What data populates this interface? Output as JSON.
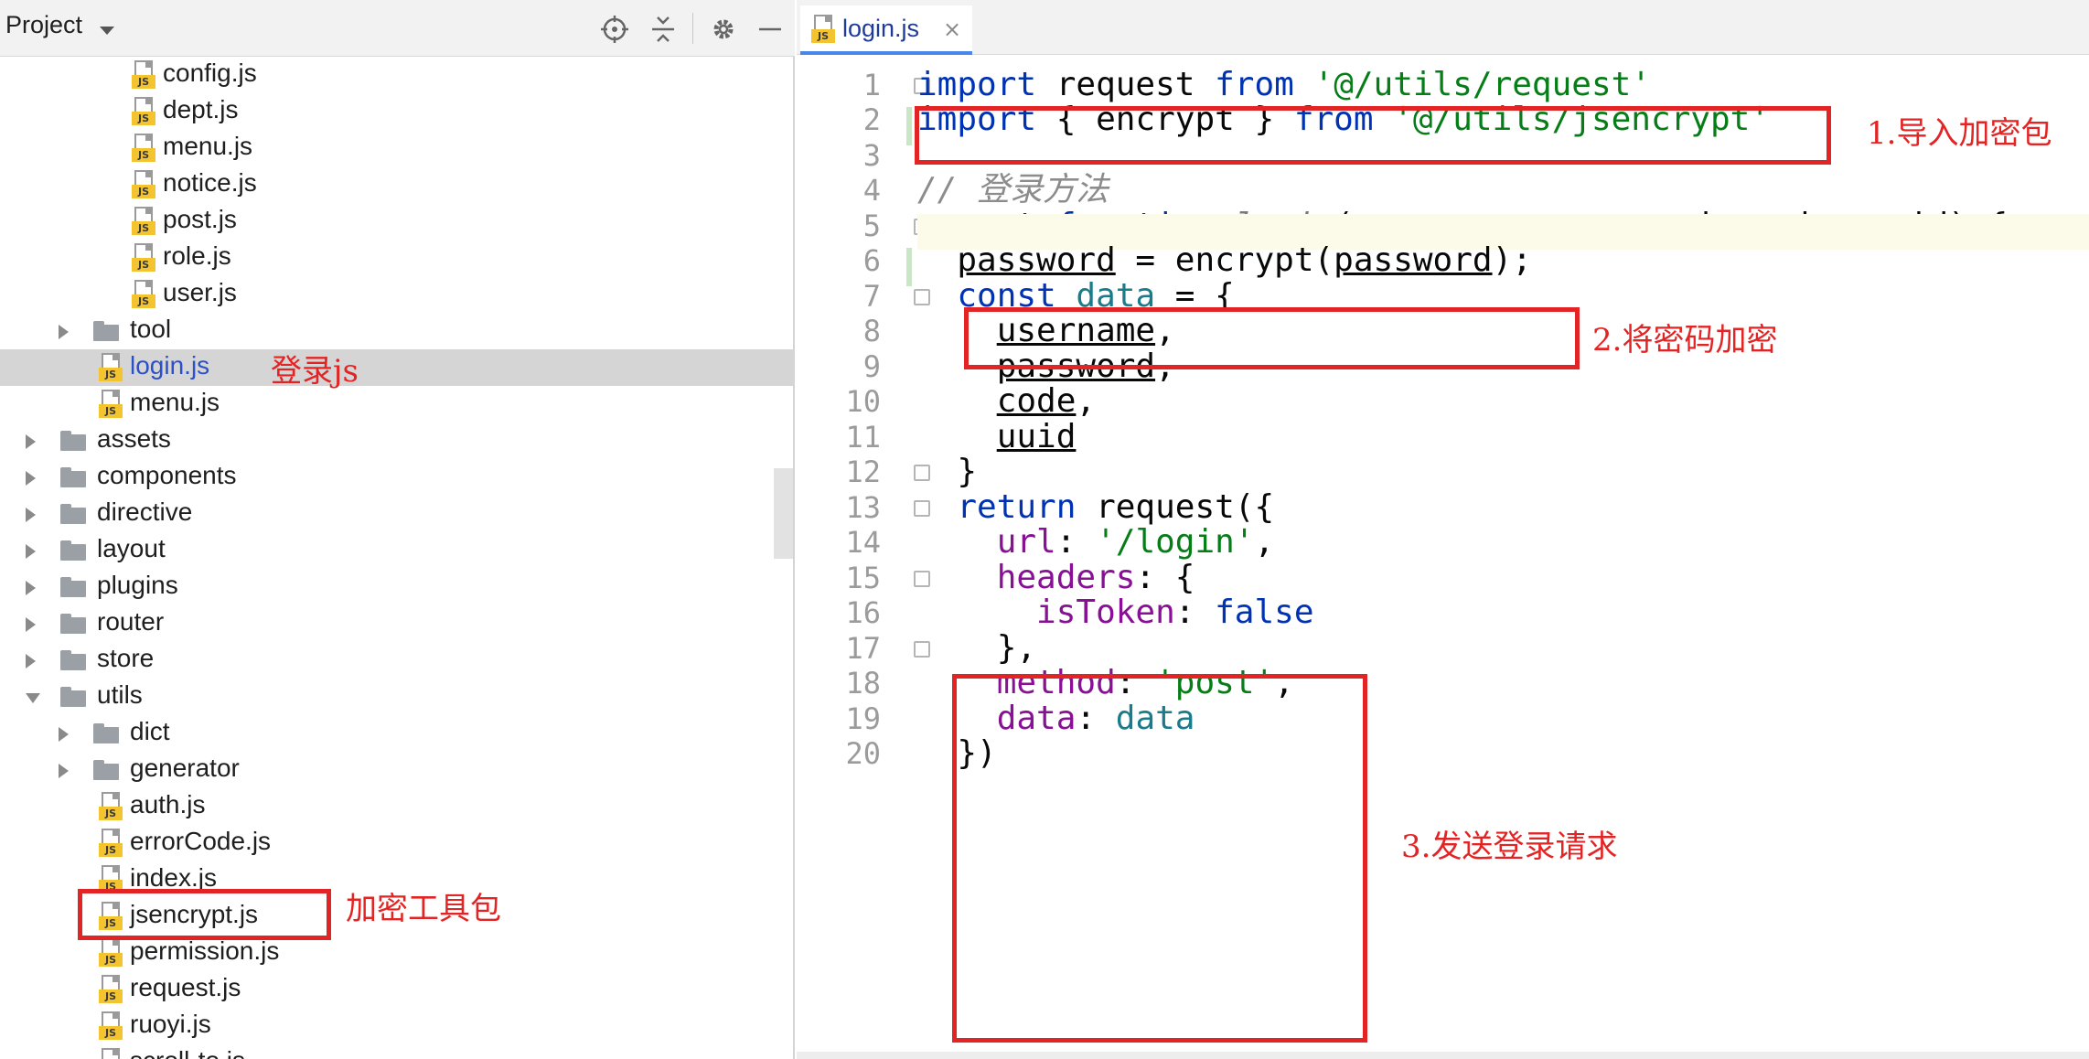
{
  "project_panel": {
    "title": "Project",
    "header_icons": [
      "locate-icon",
      "collapse-all-icon",
      "gear-icon",
      "minimize-icon"
    ],
    "tree": [
      {
        "name": "config.js",
        "type": "file",
        "depth": 3
      },
      {
        "name": "dept.js",
        "type": "file",
        "depth": 3
      },
      {
        "name": "menu.js",
        "type": "file",
        "depth": 3
      },
      {
        "name": "notice.js",
        "type": "file",
        "depth": 3
      },
      {
        "name": "post.js",
        "type": "file",
        "depth": 3
      },
      {
        "name": "role.js",
        "type": "file",
        "depth": 3
      },
      {
        "name": "user.js",
        "type": "file",
        "depth": 3
      },
      {
        "name": "tool",
        "type": "folder",
        "depth": 2,
        "expanded": false
      },
      {
        "name": "login.js",
        "type": "file",
        "depth": 2,
        "selected": true
      },
      {
        "name": "menu.js",
        "type": "file",
        "depth": 2
      },
      {
        "name": "assets",
        "type": "folder",
        "depth": 1,
        "expanded": false
      },
      {
        "name": "components",
        "type": "folder",
        "depth": 1,
        "expanded": false
      },
      {
        "name": "directive",
        "type": "folder",
        "depth": 1,
        "expanded": false
      },
      {
        "name": "layout",
        "type": "folder",
        "depth": 1,
        "expanded": false
      },
      {
        "name": "plugins",
        "type": "folder",
        "depth": 1,
        "expanded": false
      },
      {
        "name": "router",
        "type": "folder",
        "depth": 1,
        "expanded": false
      },
      {
        "name": "store",
        "type": "folder",
        "depth": 1,
        "expanded": false
      },
      {
        "name": "utils",
        "type": "folder",
        "depth": 1,
        "expanded": true
      },
      {
        "name": "dict",
        "type": "folder",
        "depth": 2,
        "expanded": false
      },
      {
        "name": "generator",
        "type": "folder",
        "depth": 2,
        "expanded": false
      },
      {
        "name": "auth.js",
        "type": "file",
        "depth": 2
      },
      {
        "name": "errorCode.js",
        "type": "file",
        "depth": 2
      },
      {
        "name": "index.js",
        "type": "file",
        "depth": 2
      },
      {
        "name": "jsencrypt.js",
        "type": "file",
        "depth": 2
      },
      {
        "name": "permission.js",
        "type": "file",
        "depth": 2
      },
      {
        "name": "request.js",
        "type": "file",
        "depth": 2
      },
      {
        "name": "ruoyi.js",
        "type": "file",
        "depth": 2
      },
      {
        "name": "scroll-to.js",
        "type": "file",
        "depth": 2
      }
    ]
  },
  "editor": {
    "tab": {
      "label": "login.js",
      "icon_badge": "JS",
      "close": "×"
    },
    "line_numbers": [
      "1",
      "2",
      "3",
      "4",
      "5",
      "6",
      "7",
      "8",
      "9",
      "10",
      "11",
      "12",
      "13",
      "14",
      "15",
      "16",
      "17",
      "18",
      "19",
      "20"
    ],
    "current_line": 6
  },
  "annotations": {
    "import_crypto": "1.导入加密包",
    "encrypt_password": "2.将密码加密",
    "send_request": "3.发送登录请求",
    "login_js": "登录js",
    "crypto_tool": "加密工具包"
  },
  "colors": {
    "annotation_red": "#e32424",
    "keyword_blue": "#0033b3",
    "string_green": "#067d17",
    "property_purple": "#871094",
    "selection_gray": "#d5d5d5"
  }
}
